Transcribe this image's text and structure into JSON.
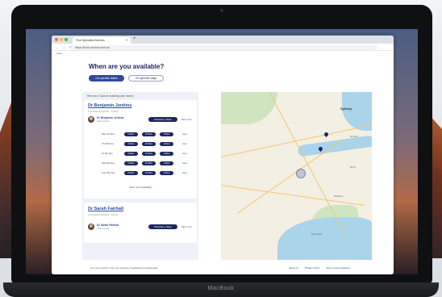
{
  "device": {
    "brand": "MacBook"
  },
  "browser": {
    "tab_title": "Find Specialist Doctors",
    "url": "https://book.doctors.com.au",
    "bookmark": "Apps"
  },
  "page": {
    "heading": "When are you available?",
    "filters": [
      {
        "label": "On specific dates"
      },
      {
        "label": "On specific days"
      }
    ],
    "results_note": "Here are 2 doctors matching your search",
    "doctors": [
      {
        "name": "Dr Benjamin Jenkins",
        "subtitle": "Consultant Physician · Sydney",
        "appointment_name": "Dr Benjamin Jenkins",
        "appointment_meta": "Video consult",
        "schedule_label": "Schedule a Video",
        "more_label": "More info",
        "slots": [
          {
            "day": "Wed 7th Nov",
            "times": [
              "9:00am",
              "10:30am",
              "1:00pm"
            ],
            "more": "more"
          },
          {
            "day": "Thu 8th Nov",
            "times": [
              "9:00am",
              "10:30am",
              "1:00pm"
            ],
            "more": "more"
          },
          {
            "day": "Fri 9th Nov",
            "times": [
              "9:00am",
              "10:30am",
              "1:00pm"
            ],
            "more": "more"
          },
          {
            "day": "Sat 10th Nov",
            "times": [
              "9:00am",
              "10:30am",
              "1:00pm"
            ],
            "more": "more"
          },
          {
            "day": "Sun 11th Nov",
            "times": [
              "9:00am",
              "10:30am",
              "1:00pm"
            ],
            "more": "more"
          }
        ],
        "show_more": "Show more availability"
      },
      {
        "name": "Dr Sarah Fairhall",
        "subtitle": "Consultant Physician · Sydney",
        "appointment_name": "Dr Sarah Fairhall",
        "appointment_meta": "Video consult",
        "schedule_label": "Schedule a Video",
        "more_label": "More info"
      }
    ],
    "map": {
      "city_label": "Sydney",
      "small_labels": [
        "Mosman",
        "Bondi",
        "Randwick",
        "Botany Bay"
      ]
    },
    "footer": {
      "left_text": "Are you a doctor? Join our network of healthcare professionals",
      "links": [
        "About us",
        "Privacy Policy",
        "Terms and Conditions"
      ]
    }
  },
  "colors": {
    "brand_navy": "#1e2761",
    "brand_blue": "#2f4a9c",
    "map_water": "#a9d4ea",
    "map_green": "#cfe5c2"
  }
}
